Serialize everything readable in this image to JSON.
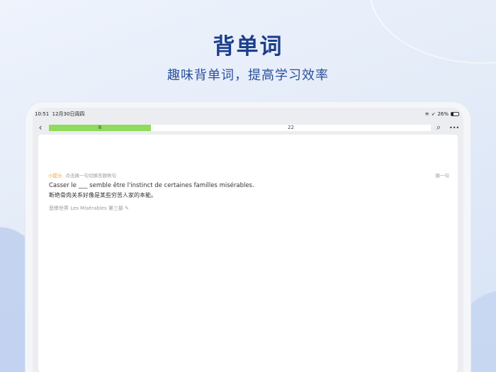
{
  "header": {
    "title": "背单词",
    "subtitle": "趣味背单词，提高学习效率"
  },
  "status_bar": {
    "time": "10:51",
    "date": "12月30日周四",
    "battery": "26%",
    "battery_level": 0.26
  },
  "progress": {
    "done_label": "8",
    "remaining_label": "22",
    "fraction": 0.267
  },
  "card": {
    "hint_tag": "小提示",
    "hint_text": "点击换一句切换答题例句",
    "swap_label": "换一句",
    "sentence_fr": "Casser le ___ semble être l'instinct de certaines familles misérables.",
    "sentence_zh": "断绝骨肉关系好像是某些穷苦人家的本能。",
    "source": "悲惨世界 Les Misérables 第三部"
  }
}
